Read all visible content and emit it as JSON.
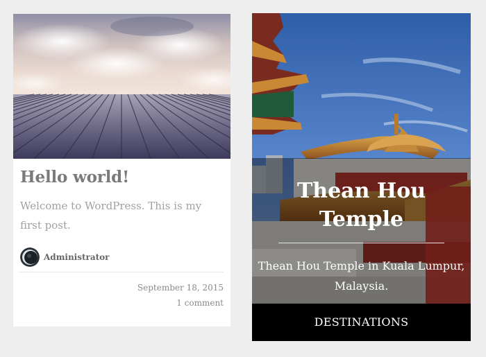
{
  "post": {
    "title": "Hello world!",
    "excerpt": "Welcome to WordPress. This is my first post.",
    "author": "Administrator",
    "date": "September 18, 2015",
    "comments": "1 comment"
  },
  "feature": {
    "title": "Thean Hou Temple",
    "description": "Thean Hou Temple in Kuala Lumpur, Malaysia.",
    "category": "DESTINATIONS"
  },
  "colors": {
    "page_background": "#eeeeee",
    "card_background": "#ffffff",
    "category_bar": "#000000"
  }
}
